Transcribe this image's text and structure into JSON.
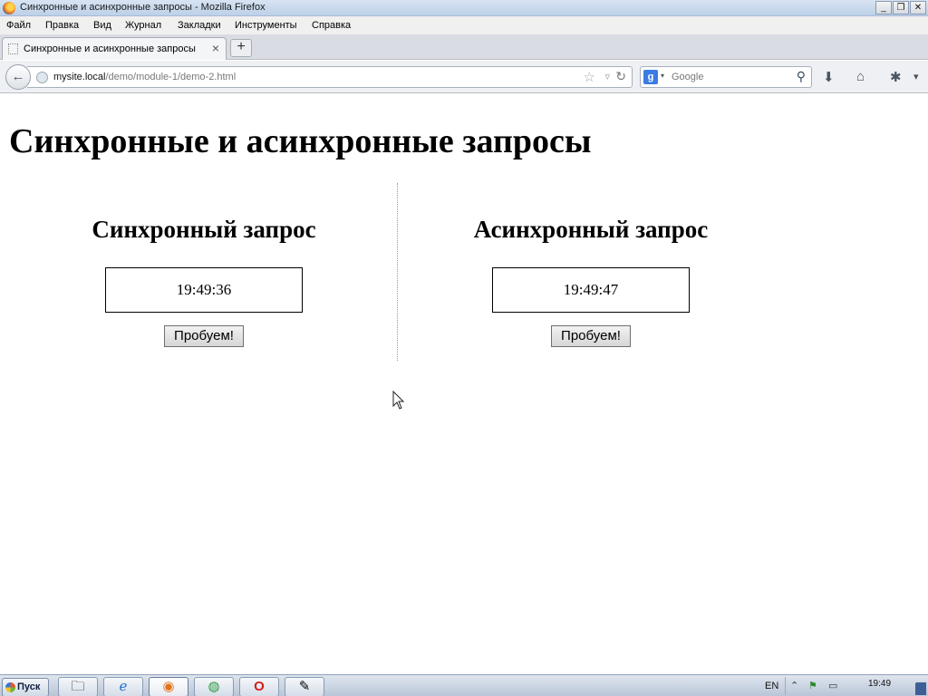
{
  "window": {
    "title": "Синхронные и асинхронные запросы - Mozilla Firefox",
    "minimize": "_",
    "maximize": "❐",
    "close": "✕"
  },
  "menu": [
    "Файл",
    "Правка",
    "Вид",
    "Журнал",
    "Закладки",
    "Инструменты",
    "Справка"
  ],
  "tab": {
    "label": "Синхронные и асинхронные запросы",
    "close": "×",
    "new_tab": "+"
  },
  "navbar": {
    "back": "←",
    "url_host": "mysite.local",
    "url_path": "/demo/module-1/demo-2.html",
    "star": "☆",
    "dropdown": "▿",
    "reload": "↻",
    "search_placeholder": "Google",
    "search_engine_letter": "g",
    "search_engine_caret": "▾",
    "search_icon": "⚲",
    "downloads": "⬇",
    "home": "⌂",
    "addons": "✱",
    "menu": "▾"
  },
  "page": {
    "title": "Синхронные и асинхронные запросы",
    "sync": {
      "heading": "Синхронный запрос",
      "time": "19:49:36",
      "button": "Пробуем!"
    },
    "async": {
      "heading": "Асинхронный запрос",
      "time": "19:49:47",
      "button": "Пробуем!"
    }
  },
  "taskbar": {
    "start": "Пуск",
    "apps": [
      {
        "icon": "folder-icon",
        "glyph": "🗀"
      },
      {
        "icon": "ie-icon",
        "glyph": "ℯ"
      },
      {
        "icon": "firefox-icon",
        "glyph": "◉"
      },
      {
        "icon": "chrome-icon",
        "glyph": "◍"
      },
      {
        "icon": "opera-icon",
        "glyph": "O"
      },
      {
        "icon": "editor-icon",
        "glyph": "✎"
      }
    ],
    "lang": "EN",
    "tray": [
      "⌃",
      "⚑",
      "▭"
    ],
    "clock": "19:49"
  },
  "colors": {
    "page_background": "#ffffff",
    "button_face": "#e0e0e0",
    "taskbar": "#c9d3e1"
  }
}
